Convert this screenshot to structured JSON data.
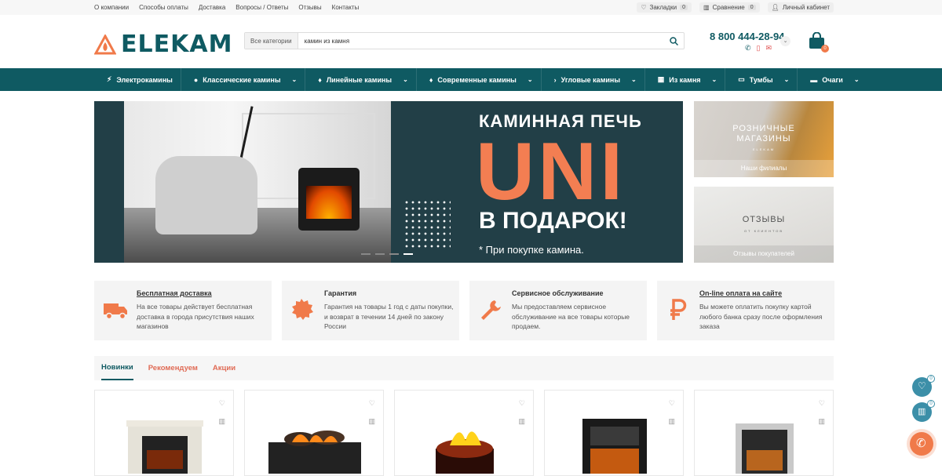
{
  "topbar": {
    "links": [
      "О компании",
      "Способы оплаты",
      "Доставка",
      "Вопросы / Ответы",
      "Отзывы",
      "Контакты"
    ],
    "bookmarks_label": "Закладки",
    "bookmarks_count": "0",
    "compare_label": "Сравнение",
    "compare_count": "0",
    "account_label": "Личный кабинет"
  },
  "header": {
    "logo": "ELEKAM",
    "search_category": "Все категории",
    "search_query": "камин из камня",
    "phone": "8 800 444-28-94",
    "cart_count": "0"
  },
  "nav": [
    {
      "label": "Электрокамины",
      "icon": "bolt-icon"
    },
    {
      "label": "Классические камины",
      "icon": "flame-icon"
    },
    {
      "label": "Линейные камины",
      "icon": "drop-icon"
    },
    {
      "label": "Современные камины",
      "icon": "drop-icon"
    },
    {
      "label": "Угловые камины",
      "icon": "angle-icon"
    },
    {
      "label": "Из камня",
      "icon": "stone-icon"
    },
    {
      "label": "Тумбы",
      "icon": "tv-icon"
    },
    {
      "label": "Очаги",
      "icon": "truck-icon"
    }
  ],
  "banner": {
    "line1": "КАМИННАЯ ПЕЧЬ",
    "line2": "UNI",
    "line3": "В ПОДАРОК!",
    "line4": "* При покупке камина."
  },
  "side_banners": [
    {
      "title": "РОЗНИЧНЫЕ\nМАГАЗИНЫ",
      "sub": "ELEKAM",
      "caption": "Наши филиалы"
    },
    {
      "title": "ОТЗЫВЫ",
      "sub": "ОТ КЛИЕНТОВ",
      "caption": "Отзывы покупателей"
    }
  ],
  "features": [
    {
      "title": "Бесплатная доставка",
      "text": "На все товары действует бесплатная доставка в города присутствия наших магазинов",
      "icon": "truck-icon"
    },
    {
      "title": "Гарантия",
      "text": "Гарантия на товары 1 год с даты покупки, и возврат в течении 14 дней по закону России",
      "icon": "badge-icon"
    },
    {
      "title": "Сервисное обслуживание",
      "text": "Мы предоставляем сервисное обслуживание на все товары которые продаем.",
      "icon": "wrench-icon"
    },
    {
      "title": "On-line оплата на сайте",
      "text": "Вы можете оплатить покупку картой любого банка сразу после оформления заказа",
      "icon": "ruble-icon"
    }
  ],
  "tabs": [
    "Новинки",
    "Рекомендуем",
    "Акции"
  ],
  "floating": {
    "wishlist_count": "0",
    "compare_count": "0"
  },
  "colors": {
    "brand": "#0f5a62",
    "accent": "#f37e52"
  }
}
